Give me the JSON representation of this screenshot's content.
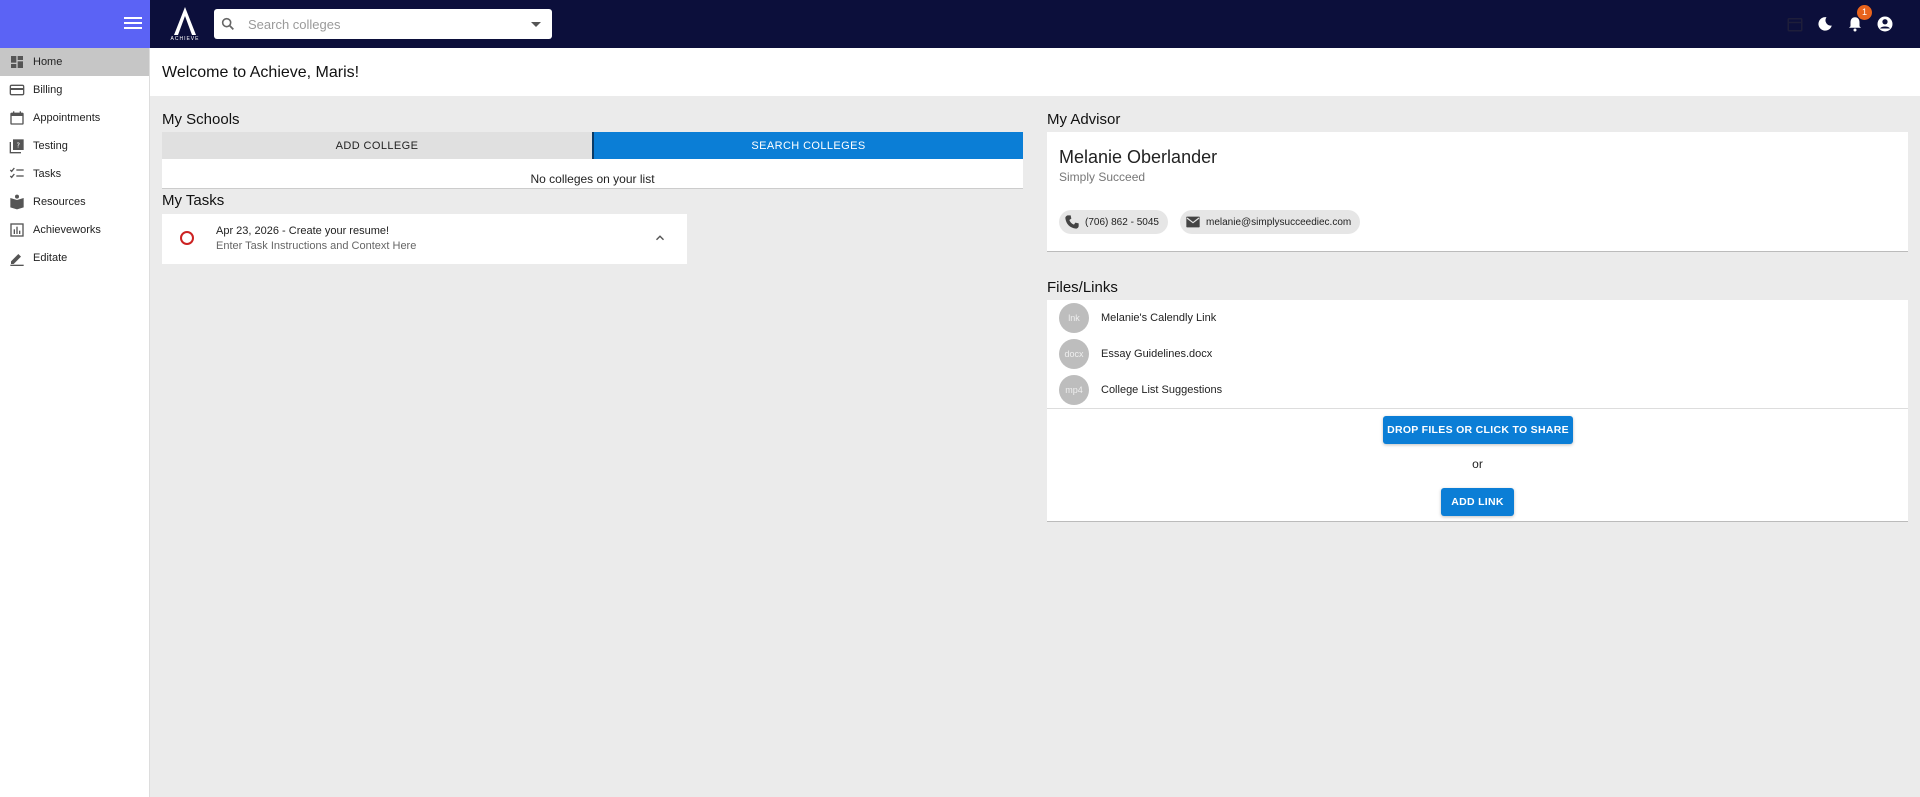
{
  "header": {
    "menu_icon": "hamburger-menu-icon",
    "logo_text": "ACHIEVE",
    "search": {
      "placeholder": "Search colleges",
      "value": ""
    },
    "notification_count": "1",
    "colors": {
      "topbar": "#0c0f3b",
      "menu_bg": "#5b63f5",
      "badge": "#e8631c"
    }
  },
  "sidebar": {
    "items": [
      {
        "label": "Home",
        "icon": "dashboard-icon",
        "active": true
      },
      {
        "label": "Billing",
        "icon": "credit-card-icon"
      },
      {
        "label": "Appointments",
        "icon": "calendar-icon"
      },
      {
        "label": "Testing",
        "icon": "quiz-icon"
      },
      {
        "label": "Tasks",
        "icon": "checklist-icon"
      },
      {
        "label": "Resources",
        "icon": "book-icon"
      },
      {
        "label": "Achieveworks",
        "icon": "bar-chart-icon"
      },
      {
        "label": "Editate",
        "icon": "edit-icon"
      }
    ]
  },
  "welcome": {
    "title": "Welcome to Achieve, Maris!"
  },
  "schools": {
    "title": "My Schools",
    "add_label": "ADD COLLEGE",
    "search_label": "SEARCH COLLEGES",
    "empty_text": "No colleges on your list"
  },
  "tasks": {
    "title": "My Tasks",
    "items": [
      {
        "title": "Apr 23, 2026 - Create your resume!",
        "subtitle": "Enter Task Instructions and Context Here"
      }
    ]
  },
  "advisor": {
    "title": "My Advisor",
    "name": "Melanie Oberlander",
    "organization": "Simply Succeed",
    "phone": "(706) 862 - 5045",
    "email": "melanie@simplysucceediec.com"
  },
  "files": {
    "title": "Files/Links",
    "items": [
      {
        "type": "lnk",
        "name": "Melanie's Calendly Link"
      },
      {
        "type": "docx",
        "name": "Essay Guidelines.docx"
      },
      {
        "type": "mp4",
        "name": "College List Suggestions"
      }
    ],
    "drop_label": "DROP FILES OR CLICK TO SHARE",
    "or_text": "or",
    "add_link_label": "ADD LINK"
  },
  "accent_color": "#0b7ed6"
}
